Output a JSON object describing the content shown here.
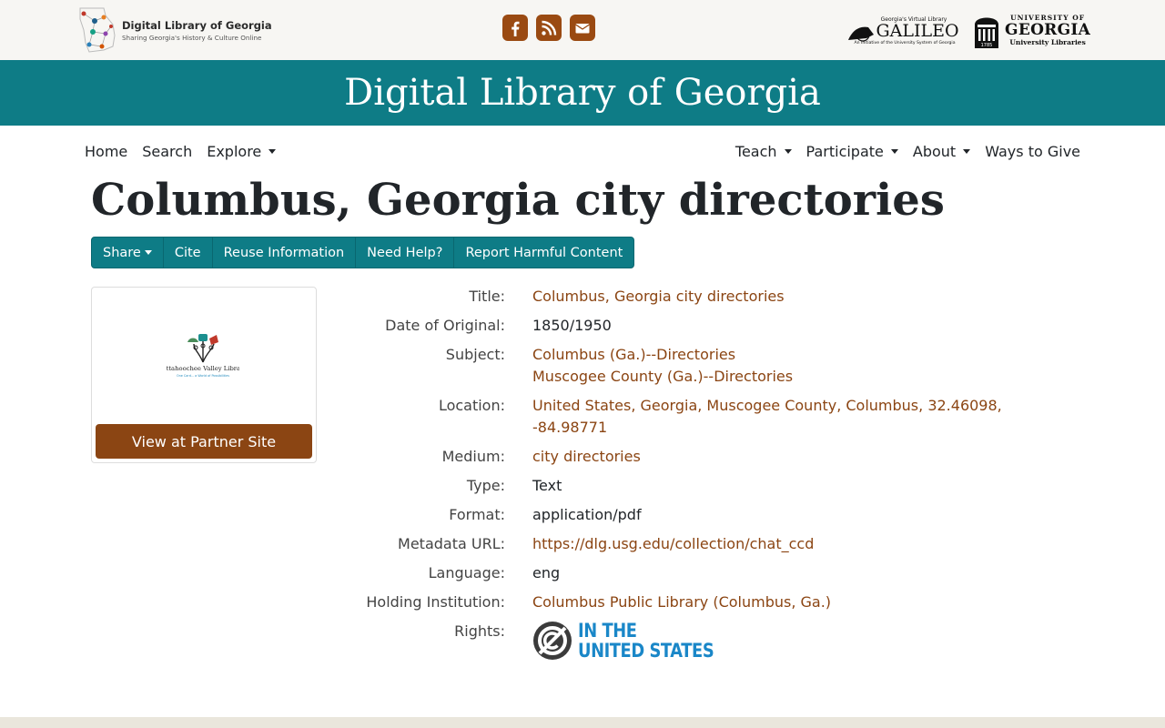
{
  "header": {
    "dlg_name": "Digital Library of Georgia",
    "dlg_tagline": "Sharing Georgia's History & Culture Online",
    "social": [
      "facebook-icon",
      "rss-icon",
      "envelope-icon"
    ],
    "galileo_top": "Georgia's Virtual Library",
    "galileo_name": "GALILEO",
    "galileo_sub": "An Initiative of the University System of Georgia",
    "uga_line1": "UNIVERSITY OF",
    "uga_line2": "GEORGIA",
    "uga_line3": "University Libraries",
    "uga_year": "1785"
  },
  "banner": {
    "title": "Digital Library of Georgia"
  },
  "nav": {
    "left": [
      {
        "label": "Home",
        "dropdown": false
      },
      {
        "label": "Search",
        "dropdown": false
      },
      {
        "label": "Explore",
        "dropdown": true
      }
    ],
    "right": [
      {
        "label": "Teach",
        "dropdown": true
      },
      {
        "label": "Participate",
        "dropdown": true
      },
      {
        "label": "About",
        "dropdown": true
      },
      {
        "label": "Ways to Give",
        "dropdown": false
      }
    ]
  },
  "page": {
    "title": "Columbus, Georgia city directories"
  },
  "toolbar": {
    "share": "Share",
    "cite": "Cite",
    "reuse": "Reuse Information",
    "help": "Need Help?",
    "report": "Report Harmful Content"
  },
  "thumbnail": {
    "library_name": "Chattahoochee Valley Libraries",
    "library_tagline": "One Card... a World of Possibilities",
    "button": "View at Partner Site"
  },
  "metadata": {
    "title_label": "Title:",
    "title_value": "Columbus, Georgia city directories",
    "date_label": "Date of Original:",
    "date_value": "1850/1950",
    "subject_label": "Subject:",
    "subject_values": [
      "Columbus (Ga.)--Directories",
      "Muscogee County (Ga.)--Directories"
    ],
    "location_label": "Location:",
    "location_line1": "United States, Georgia, Muscogee County, Columbus, 32.46098,",
    "location_line2": "-84.98771",
    "medium_label": "Medium:",
    "medium_value": "city directories",
    "type_label": "Type:",
    "type_value": "Text",
    "format_label": "Format:",
    "format_value": "application/pdf",
    "metadata_url_label": "Metadata URL:",
    "metadata_url_value": "https://dlg.usg.edu/collection/chat_ccd",
    "language_label": "Language:",
    "language_value": "eng",
    "holding_label": "Holding Institution:",
    "holding_value": "Columbus Public Library (Columbus, Ga.)",
    "rights_label": "Rights:",
    "rights_line1": "IN THE",
    "rights_line2": "UNITED STATES"
  },
  "colors": {
    "banner": "#0e7c86",
    "link": "#8b4513",
    "button": "#8b4513",
    "rights_blue": "#1a87c8"
  }
}
